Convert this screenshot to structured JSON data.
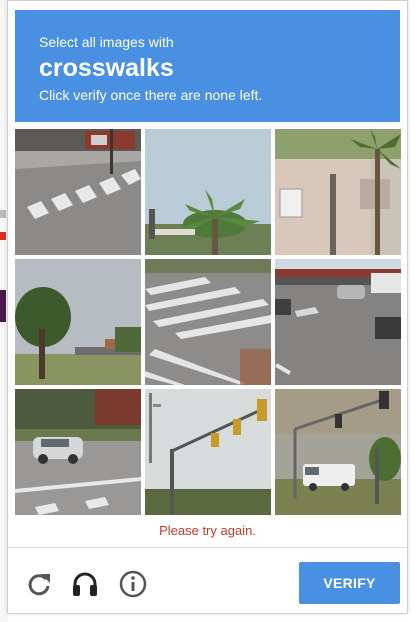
{
  "header": {
    "line1": "Select all images with",
    "keyword": "crosswalks",
    "line3": "Click verify once there are none left."
  },
  "tiles": [
    {
      "id": "tile-1",
      "content": "road-with-crosswalk"
    },
    {
      "id": "tile-2",
      "content": "palm-tree"
    },
    {
      "id": "tile-3",
      "content": "building-with-palm"
    },
    {
      "id": "tile-4",
      "content": "tree-by-road"
    },
    {
      "id": "tile-5",
      "content": "crosswalk-closeup"
    },
    {
      "id": "tile-6",
      "content": "street-with-cars"
    },
    {
      "id": "tile-7",
      "content": "white-car-on-street"
    },
    {
      "id": "tile-8",
      "content": "traffic-lights"
    },
    {
      "id": "tile-9",
      "content": "truck-and-signal-pole"
    }
  ],
  "error_message": "Please try again.",
  "footer": {
    "reload_icon": "reload-icon",
    "audio_icon": "headphones-icon",
    "info_icon": "info-icon",
    "verify_label": "VERIFY"
  },
  "colors": {
    "header_bg": "#4a90e2",
    "button_bg": "#4a90e2",
    "error_text": "#c23b2f",
    "icon_gray": "#555555"
  }
}
